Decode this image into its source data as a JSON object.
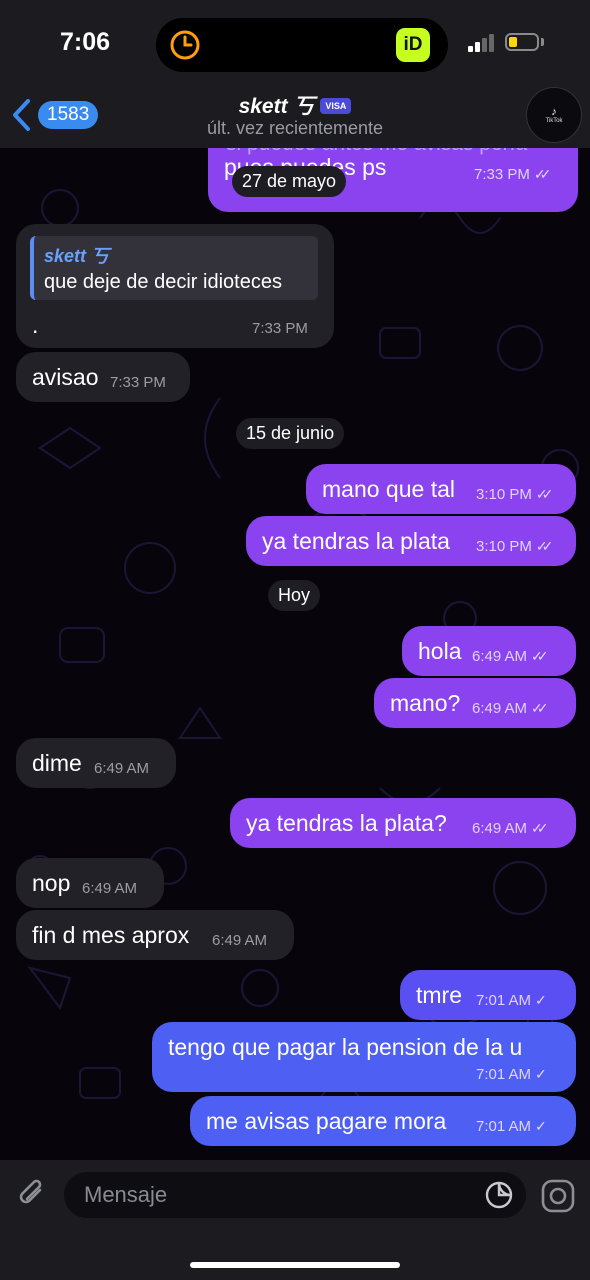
{
  "status_bar": {
    "time": "7:06",
    "island_app_label": "iD"
  },
  "header": {
    "back_count": "1583",
    "title": "skett 丂",
    "badge": "VISA",
    "subtitle": "últ. vez recientemente",
    "avatar_label": "TikTok"
  },
  "messages": {
    "m1_text": "pues puedes ps",
    "m1_quote_partial": "si puedes antes me avisas porfa",
    "m1_time": "7:33 PM",
    "m2_reply_name": "skett 丂",
    "m2_reply_text": "que deje de decir idioteces",
    "m2_text": ".",
    "m2_time": "7:33 PM",
    "m3_text": "avisao",
    "m3_time": "7:33 PM",
    "m4_text": "mano que tal",
    "m4_time": "3:10 PM",
    "m5_text": "ya tendras la plata",
    "m5_time": "3:10 PM",
    "m6_text": "hola",
    "m6_time": "6:49 AM",
    "m7_text": "mano?",
    "m7_time": "6:49 AM",
    "m8_text": "dime",
    "m8_time": "6:49 AM",
    "m9_text": "ya tendras la plata?",
    "m9_time": "6:49 AM",
    "m10_text": "nop",
    "m10_time": "6:49 AM",
    "m11_text": "fin d mes aprox",
    "m11_time": "6:49 AM",
    "m12_text": "tmre",
    "m12_time": "7:01 AM",
    "m13_text": "tengo que pagar la pension de la u",
    "m13_time": "7:01 AM",
    "m14_text": "me avisas pagare mora",
    "m14_time": "7:01 AM"
  },
  "dates": {
    "d1": "27 de mayo",
    "d2": "15 de junio",
    "d3": "Hoy"
  },
  "input": {
    "placeholder": "Mensaje"
  },
  "colors": {
    "outgoing": "#8a43ee",
    "incoming": "#222127",
    "accent": "#3a8bf0"
  }
}
